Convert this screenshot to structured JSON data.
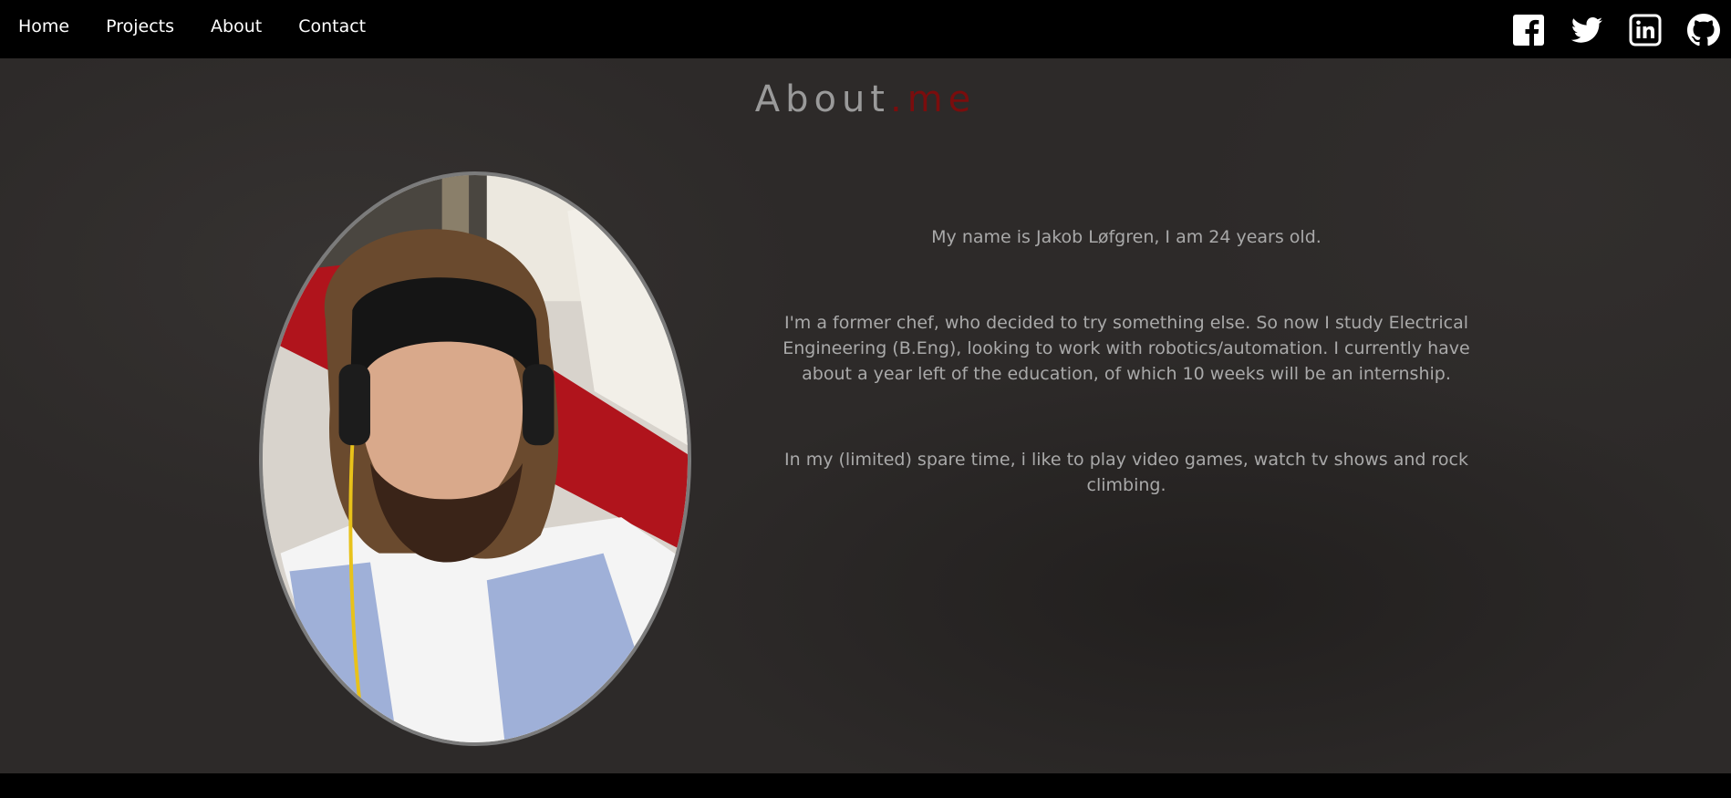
{
  "nav": {
    "links": [
      "Home",
      "Projects",
      "About",
      "Contact"
    ]
  },
  "social": {
    "icons": [
      "facebook-icon",
      "twitter-icon",
      "linkedin-icon",
      "github-icon"
    ]
  },
  "about": {
    "title_main": "About",
    "title_accent": ".me",
    "paragraphs": [
      "My name is Jakob Løfgren, I am 24 years old.",
      "I'm a former chef, who decided to try something else. So now I study Electrical Engineering (B.Eng), looking to work with robotics/automation. I currently have about a year left of the education, of which 10 weeks will be an internship.",
      "In my (limited) spare time, i like to play video games, watch tv shows and rock climbing."
    ]
  },
  "colors": {
    "background": "#2d2a29",
    "navbar": "#000000",
    "accent": "#7a0d0d",
    "text": "#a9a9a9"
  }
}
